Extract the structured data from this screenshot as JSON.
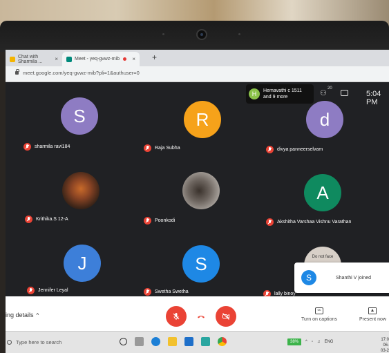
{
  "browser": {
    "tabs": [
      {
        "label": "Chat with Sharmila ...",
        "icon_color": "#f4b400"
      },
      {
        "label": "Meet - yeq-gvwz-mib",
        "icon_color": "#00897b"
      }
    ],
    "tab_close": "×",
    "new_tab": "+",
    "url": "meet.google.com/yeq-gvwz-mib?pli=1&authuser=0"
  },
  "meet": {
    "notification": {
      "badge": "H",
      "line1": "Hemavathi c 1511",
      "line2": "and 9 more",
      "badge_color": "#8bc34a"
    },
    "participants_count": "20",
    "time": "5:04 PM",
    "participants": [
      {
        "name": "sharmila ravi184",
        "initial": "S",
        "color": "#8e7cc3"
      },
      {
        "name": "Raja Subha",
        "initial": "R",
        "color": "#f6a21a"
      },
      {
        "name": "divya panneerselvam",
        "initial": "d",
        "color": "#8e7cc3"
      },
      {
        "name": "Krithika.S 12-A",
        "initial": "",
        "color": "#5a3b2a"
      },
      {
        "name": "Poonkodi",
        "initial": "",
        "color": "#7a7470"
      },
      {
        "name": "Akshitha Varshaa Vishnu Varathan",
        "initial": "A",
        "color": "#0f8a5f"
      },
      {
        "name": "Jennifer Leyal",
        "initial": "J",
        "color": "#3d7fd9"
      },
      {
        "name": "Swetha Swetha",
        "initial": "S",
        "color": "#1e88e5"
      },
      {
        "name": "lally binoy",
        "initial": "",
        "color": "#d8d0c8"
      }
    ],
    "partial_photo_text": "Do not face",
    "toast": {
      "initial": "S",
      "text": "Shanthi V joined"
    }
  },
  "controls": {
    "meeting_details": "ing details",
    "captions": "Turn on captions",
    "present": "Present now"
  },
  "taskbar": {
    "search_placeholder": "Type here to search",
    "battery": "38%",
    "lang": "ENG",
    "time": "17:0",
    "date": "06-03-2"
  }
}
